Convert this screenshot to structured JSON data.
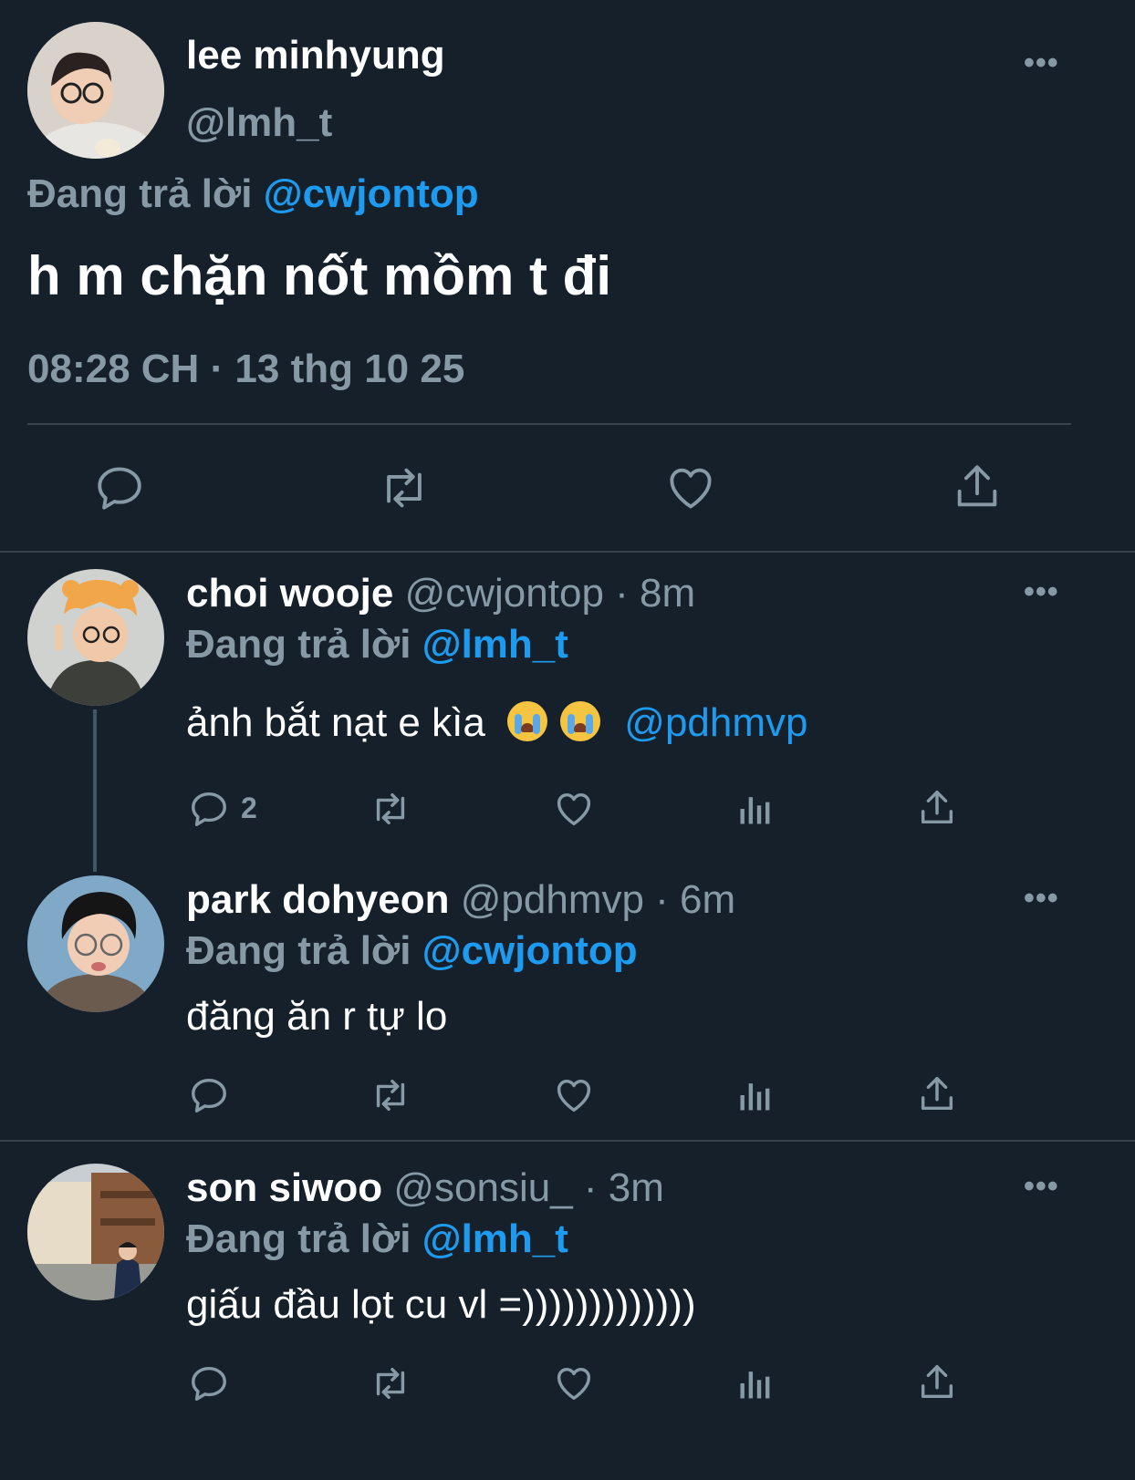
{
  "main_tweet": {
    "display_name": "lee minhyung",
    "handle": "@lmh_t",
    "replying_prefix": "Đang trả lời",
    "replying_to": "@cwjontop",
    "text": "h m chặn nốt mồm t đi",
    "timestamp": "08:28 CH · 13 thg 10 25"
  },
  "replies": [
    {
      "display_name": "choi wooje",
      "handle": "@cwjontop",
      "time": "· 8m",
      "replying_prefix": "Đang trả lời",
      "replying_to": "@lmh_t",
      "text": "ảnh bắt nạt e kìa",
      "mention": "@pdhmvp",
      "reply_count": "2"
    },
    {
      "display_name": "park dohyeon",
      "handle": "@pdhmvp",
      "time": "· 6m",
      "replying_prefix": "Đang trả lời",
      "replying_to": "@cwjontop",
      "text": "đăng ăn r tự lo"
    },
    {
      "display_name": "son siwoo",
      "handle": "@sonsiu_",
      "time": "· 3m",
      "replying_prefix": "Đang trả lời",
      "replying_to": "@lmh_t",
      "text": "giấu đầu lọt cu vl =)))))))))))))"
    }
  ],
  "icons": {
    "more": "more-icon",
    "reply": "reply-icon",
    "retweet": "retweet-icon",
    "like": "like-icon",
    "views": "views-icon",
    "share": "share-icon"
  },
  "colors": {
    "background": "#15202b",
    "link": "#1d9bf0",
    "muted": "#8899a6",
    "divider": "#38444d"
  }
}
